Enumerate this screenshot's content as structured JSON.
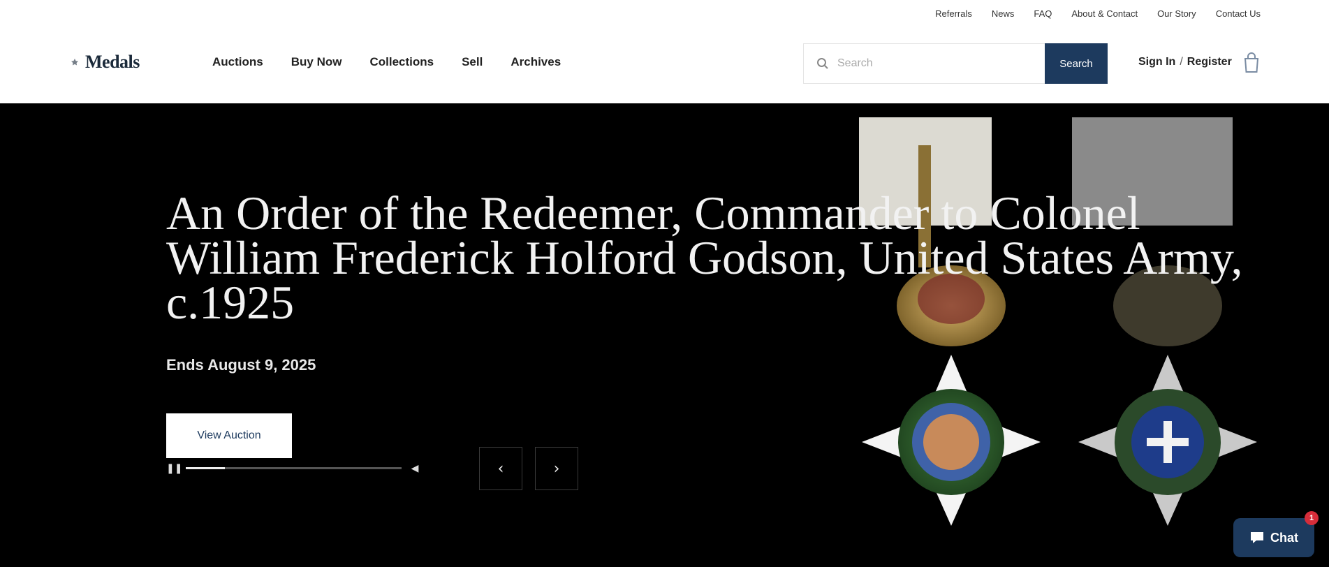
{
  "utility_nav": [
    "Referrals",
    "News",
    "FAQ",
    "About & Contact",
    "Our Story",
    "Contact Us"
  ],
  "logo": {
    "text": "Medals",
    "icon": "medal-logo-icon"
  },
  "main_nav": [
    "Auctions",
    "Buy Now",
    "Collections",
    "Sell",
    "Archives"
  ],
  "search": {
    "placeholder": "Search",
    "button_label": "Search",
    "icon": "search-icon"
  },
  "auth": {
    "sign_in": "Sign In",
    "separator": "/",
    "register": "Register"
  },
  "cart": {
    "icon": "cart-icon"
  },
  "hero": {
    "title": "An Order of the Redeemer, Commander to Colonel William Frederick Holford Godson, United States Army, c.1925",
    "date": "Ends August 9, 2025",
    "button_label": "View Auction",
    "prev_label": "‹",
    "next_label": "›",
    "progress_fraction": 0.18,
    "pause_icon": "pause-icon",
    "volume_icon": "speaker-icon"
  },
  "chat": {
    "label": "Chat",
    "badge": "1",
    "icon": "chat-bubble-icon"
  },
  "colors": {
    "brand": "#1d3a5e",
    "hero_bg": "#000000",
    "badge": "#d62d3a"
  }
}
